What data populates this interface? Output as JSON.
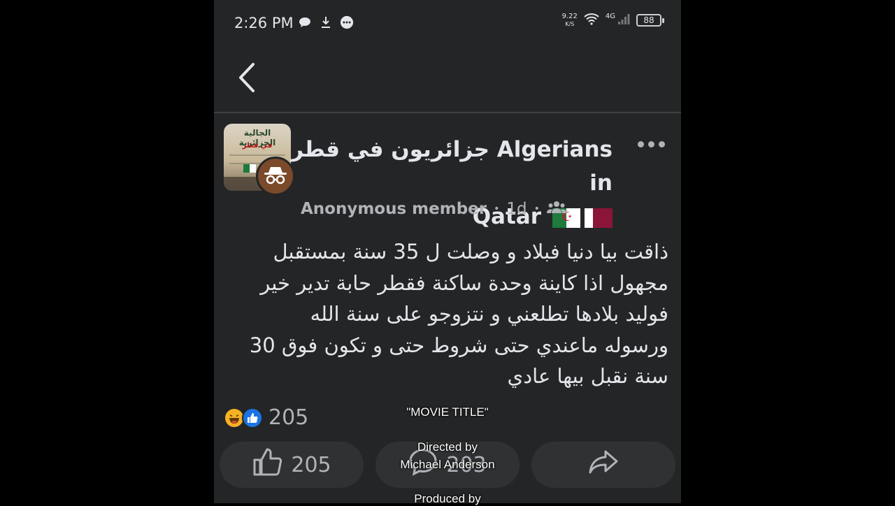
{
  "status_bar": {
    "time": "2:26 PM",
    "net_speed_value": "9.22",
    "net_speed_unit": "K/S",
    "network": "4G",
    "battery": "88",
    "icons": [
      "chat-bubble-icon",
      "download-icon",
      "message-icon",
      "wifi-icon",
      "signal-icon",
      "battery-icon"
    ]
  },
  "nav": {
    "back_icon": "chevron-left-icon"
  },
  "post": {
    "group_name_line1": "جزائريون في قطر Algerians in",
    "group_name_line2": "Qatar",
    "group_image_title": "الجالية الجزائرية",
    "group_image_subtitle": "في قطر",
    "author": "Anonymous member",
    "time_ago": "1d",
    "audience_icon": "group-icon",
    "text": "ذاقت بيا دنيا فبلاد و وصلت ل 35 سنة بمستقبل\nمجهول اذا كاينة وحدة ساكنة فقطر حابة تدير خير\nفوليد بلادها تطلعني و نتزوجو على سنة الله\nورسوله ماعندي حتى شروط حتى و تكون فوق 30\nسنة نقبل بيها عادي",
    "reaction_count": "205",
    "like_count": "205",
    "comment_count": "203"
  },
  "overlay": {
    "movie_title": "\"MOVIE TITLE\"",
    "directed_by": "Directed by",
    "director": "Michael Anderson",
    "produced_by": "Produced by"
  },
  "colors": {
    "background": "#242526",
    "text": "#e4e6eb",
    "secondary_text": "#b0b3b8",
    "button_bg": "#303132",
    "like_blue": "#1b74e4",
    "haha_yellow": "#f7b125"
  }
}
